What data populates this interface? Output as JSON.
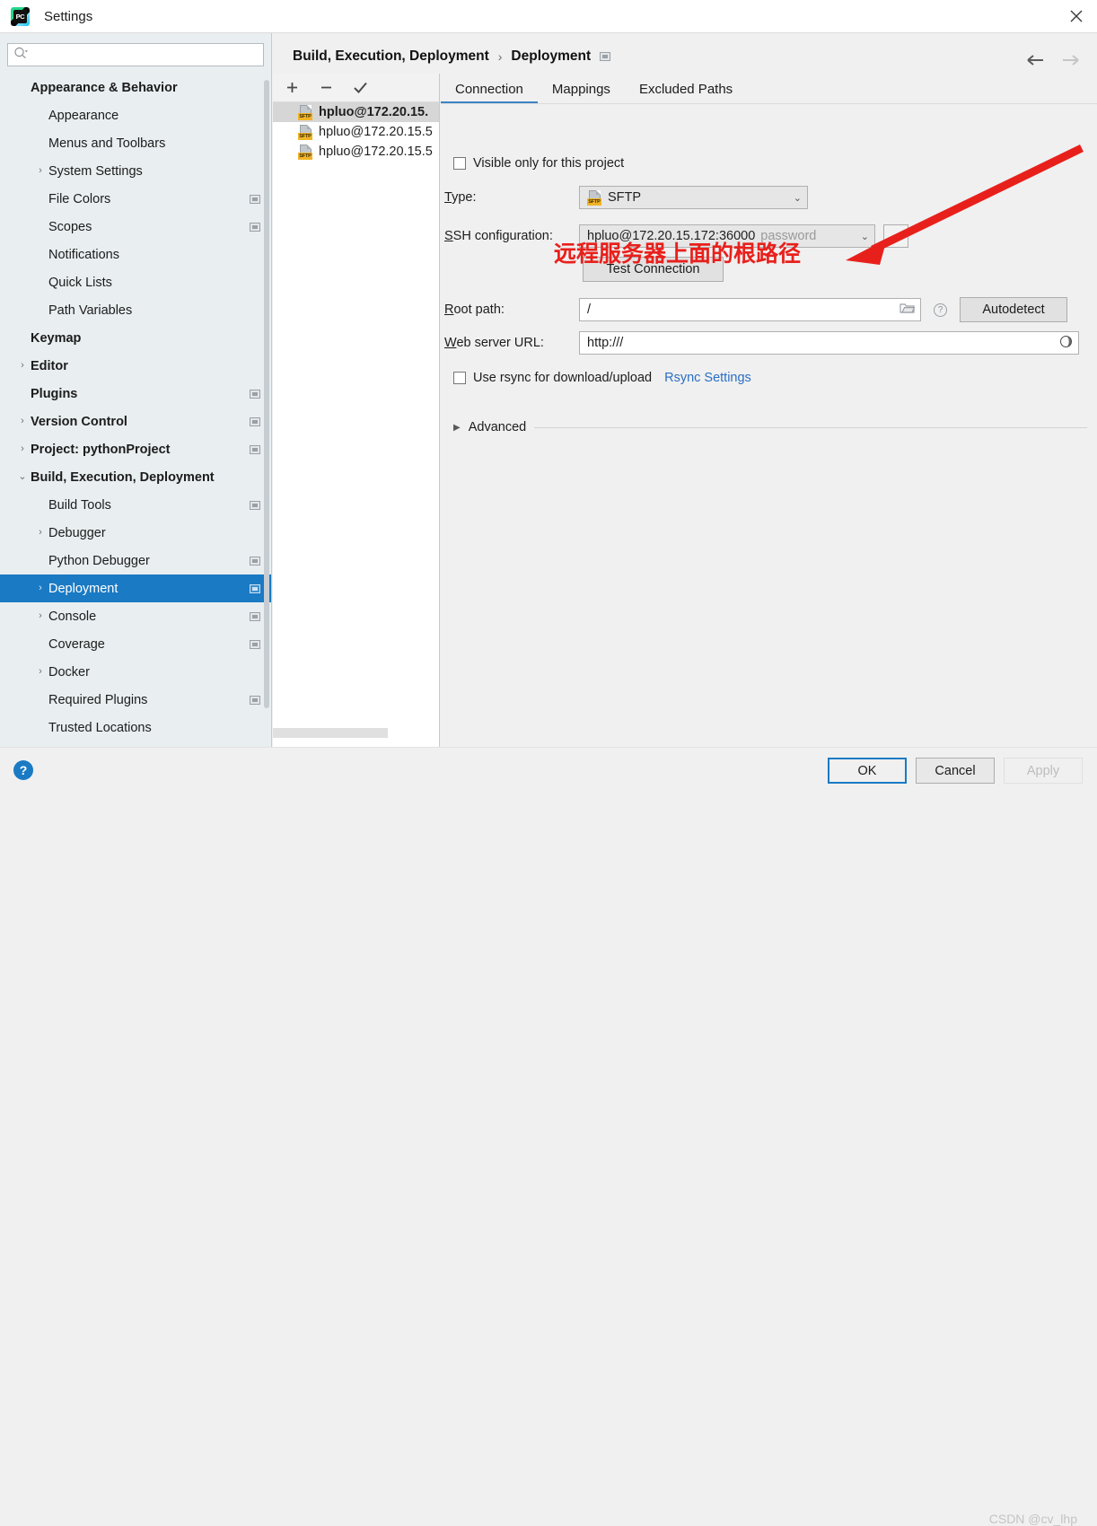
{
  "window": {
    "title": "Settings",
    "app_icon": "pycharm-icon",
    "close_icon": "close-icon"
  },
  "sidebar": {
    "search": {
      "placeholder": "",
      "value": "",
      "icon": "search-icon"
    },
    "items": [
      {
        "label": "Appearance & Behavior",
        "indent": 0,
        "bold": true,
        "arrow": "",
        "mark": false
      },
      {
        "label": "Appearance",
        "indent": 1,
        "bold": false,
        "arrow": "",
        "mark": false
      },
      {
        "label": "Menus and Toolbars",
        "indent": 1,
        "bold": false,
        "arrow": "",
        "mark": false
      },
      {
        "label": "System Settings",
        "indent": 1,
        "bold": false,
        "arrow": "›",
        "mark": false
      },
      {
        "label": "File Colors",
        "indent": 1,
        "bold": false,
        "arrow": "",
        "mark": true
      },
      {
        "label": "Scopes",
        "indent": 1,
        "bold": false,
        "arrow": "",
        "mark": true
      },
      {
        "label": "Notifications",
        "indent": 1,
        "bold": false,
        "arrow": "",
        "mark": false
      },
      {
        "label": "Quick Lists",
        "indent": 1,
        "bold": false,
        "arrow": "",
        "mark": false
      },
      {
        "label": "Path Variables",
        "indent": 1,
        "bold": false,
        "arrow": "",
        "mark": false
      },
      {
        "label": "Keymap",
        "indent": 0,
        "bold": true,
        "arrow": "",
        "mark": false
      },
      {
        "label": "Editor",
        "indent": 0,
        "bold": true,
        "arrow": "›",
        "mark": false
      },
      {
        "label": "Plugins",
        "indent": 0,
        "bold": true,
        "arrow": "",
        "mark": true
      },
      {
        "label": "Version Control",
        "indent": 0,
        "bold": true,
        "arrow": "›",
        "mark": true
      },
      {
        "label": "Project: pythonProject",
        "indent": 0,
        "bold": true,
        "arrow": "›",
        "mark": true
      },
      {
        "label": "Build, Execution, Deployment",
        "indent": 0,
        "bold": true,
        "arrow": "⌄",
        "mark": false
      },
      {
        "label": "Build Tools",
        "indent": 1,
        "bold": false,
        "arrow": "",
        "mark": true
      },
      {
        "label": "Debugger",
        "indent": 1,
        "bold": false,
        "arrow": "›",
        "mark": false
      },
      {
        "label": "Python Debugger",
        "indent": 1,
        "bold": false,
        "arrow": "",
        "mark": true
      },
      {
        "label": "Deployment",
        "indent": 1,
        "bold": false,
        "arrow": "›",
        "mark": true,
        "selected": true
      },
      {
        "label": "Console",
        "indent": 1,
        "bold": false,
        "arrow": "›",
        "mark": true
      },
      {
        "label": "Coverage",
        "indent": 1,
        "bold": false,
        "arrow": "",
        "mark": true
      },
      {
        "label": "Docker",
        "indent": 1,
        "bold": false,
        "arrow": "›",
        "mark": false
      },
      {
        "label": "Required Plugins",
        "indent": 1,
        "bold": false,
        "arrow": "",
        "mark": true
      },
      {
        "label": "Trusted Locations",
        "indent": 1,
        "bold": false,
        "arrow": "",
        "mark": false
      }
    ]
  },
  "breadcrumb": {
    "parent": "Build, Execution, Deployment",
    "separator": "›",
    "current": "Deployment",
    "back_icon": "arrow-left-icon",
    "forward_icon": "arrow-right-icon"
  },
  "server_panel": {
    "toolbar": {
      "add_label": "+",
      "remove_label": "−",
      "check_label": "✓"
    },
    "servers": [
      {
        "name": "hpluo@172.20.15.",
        "icon": "sftp-icon",
        "badge": "SFTP",
        "selected": true
      },
      {
        "name": "hpluo@172.20.15.5",
        "icon": "sftp-icon",
        "badge": "SFTP",
        "selected": false
      },
      {
        "name": "hpluo@172.20.15.5",
        "icon": "sftp-icon",
        "badge": "SFTP",
        "selected": false
      }
    ]
  },
  "tabs": [
    {
      "label": "Connection",
      "active": true
    },
    {
      "label": "Mappings",
      "active": false
    },
    {
      "label": "Excluded Paths",
      "active": false
    }
  ],
  "connection": {
    "visible_only_label": "Visible only for this project",
    "visible_only_checked": false,
    "type_label": "Type:",
    "type_label_mnemonic": "T",
    "type_value": "SFTP",
    "type_icon": "sftp-icon",
    "type_badge": "SFTP",
    "ssh_label": "SSH configuration:",
    "ssh_label_mnemonic": "S",
    "ssh_value": "hpluo@172.20.15.172:36000",
    "ssh_value_suffix": "password",
    "ssh_browse_label": "...",
    "test_connection_label": "Test Connection",
    "root_path_label": "Root path:",
    "root_path_label_mnemonic": "R",
    "root_path_value": "/",
    "root_path_folder_icon": "folder-icon",
    "root_path_help_icon": "help-icon",
    "autodetect_label": "Autodetect",
    "web_url_label": "Web server URL:",
    "web_url_label_mnemonic": "W",
    "web_url_value": "http:///",
    "web_url_globe_icon": "globe-icon",
    "rsync_label": "Use rsync for download/upload",
    "rsync_checked": false,
    "rsync_settings_link": "Rsync Settings",
    "advanced_label": "Advanced",
    "advanced_expanded": false
  },
  "annotation": {
    "text": "远程服务器上面的根路径",
    "color": "#e8201c",
    "arrow": "red-arrow-annotation"
  },
  "footer": {
    "help_icon": "help-icon",
    "ok_label": "OK",
    "cancel_label": "Cancel",
    "apply_label": "Apply",
    "apply_disabled": true,
    "watermark": "CSDN @cv_lhp"
  },
  "colors": {
    "accent": "#1a7ac4",
    "tab_underline": "#3c84c6",
    "annotation_red": "#e8201c",
    "sidebar_bg": "#e9eef1",
    "link": "#2a6fc4"
  }
}
